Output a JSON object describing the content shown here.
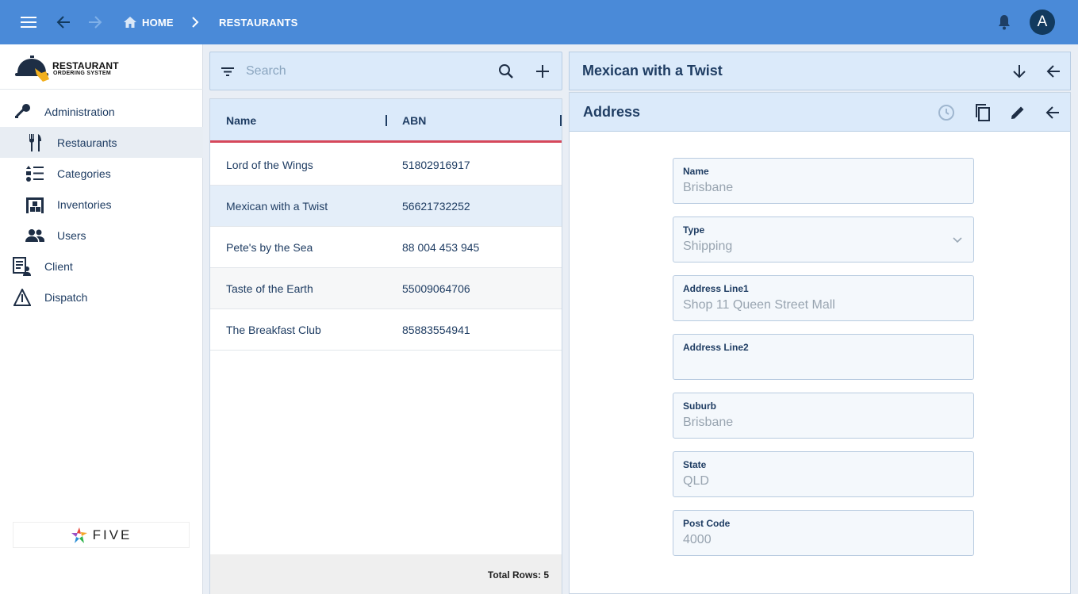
{
  "topbar": {
    "home_label": "HOME",
    "current_label": "RESTAURANTS",
    "avatar_letter": "A",
    "color": "#4a8ad8"
  },
  "sidebar": {
    "logo_title": "RESTAURANT",
    "logo_subtitle": "ORDERING SYSTEM",
    "items": [
      {
        "label": "Administration",
        "icon": "key-icon"
      },
      {
        "label": "Restaurants",
        "icon": "fork-knife-icon",
        "active": true
      },
      {
        "label": "Categories",
        "icon": "list-icon"
      },
      {
        "label": "Inventories",
        "icon": "warehouse-icon"
      },
      {
        "label": "Users",
        "icon": "users-icon"
      },
      {
        "label": "Client",
        "icon": "client-form-icon"
      },
      {
        "label": "Dispatch",
        "icon": "warning-triangle-icon"
      }
    ],
    "footer_brand": "FIVE"
  },
  "search": {
    "placeholder": "Search"
  },
  "list": {
    "columns": [
      "Name",
      "ABN"
    ],
    "rows": [
      {
        "name": "Lord of the Wings",
        "abn": "51802916917"
      },
      {
        "name": "Mexican with a Twist",
        "abn": "56621732252",
        "selected": true
      },
      {
        "name": "Pete's by the Sea",
        "abn": "88 004 453 945"
      },
      {
        "name": "Taste of the Earth",
        "abn": "55009064706"
      },
      {
        "name": "The Breakfast Club",
        "abn": "85883554941"
      }
    ],
    "total": "Total Rows: 5"
  },
  "detail": {
    "title": "Mexican with a Twist",
    "form_title": "Address",
    "fields": [
      {
        "label": "Name",
        "value": "Brisbane"
      },
      {
        "label": "Type",
        "value": "Shipping",
        "dropdown": true
      },
      {
        "label": "Address Line1",
        "value": "Shop 11 Queen Street Mall"
      },
      {
        "label": "Address Line2",
        "value": ""
      },
      {
        "label": "Suburb",
        "value": "Brisbane"
      },
      {
        "label": "State",
        "value": "QLD"
      },
      {
        "label": "Post Code",
        "value": "4000"
      }
    ]
  },
  "colors": {
    "accent": "#d6485b",
    "header_bg": "#dbeafa",
    "text": "#1f3d63"
  }
}
